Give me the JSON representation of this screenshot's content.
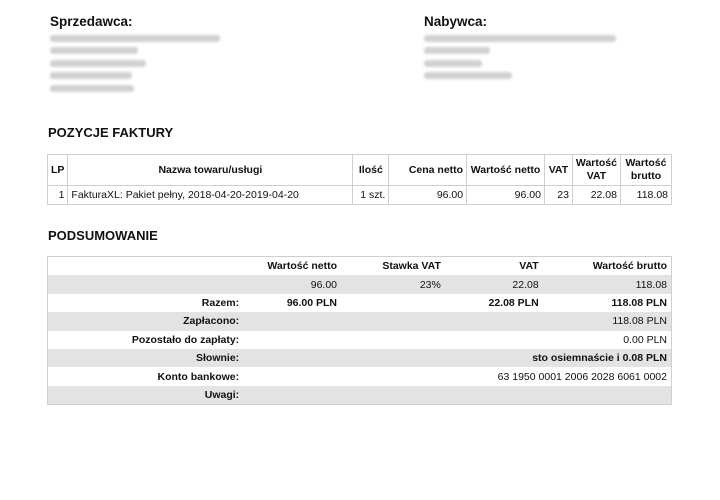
{
  "seller": {
    "title": "Sprzedawca:"
  },
  "buyer": {
    "title": "Nabywca:"
  },
  "items_section": {
    "title": "POZYCJE FAKTURY",
    "headers": {
      "lp": "LP",
      "name": "Nazwa towaru/usługi",
      "qty": "Ilość",
      "unit_net": "Cena netto",
      "net_value": "Wartość netto",
      "vat": "VAT",
      "vat_value_1": "Wartość",
      "vat_value_2": "VAT",
      "gross_1": "Wartość",
      "gross_2": "brutto"
    },
    "rows": [
      {
        "lp": "1",
        "name": "FakturaXL: Pakiet pełny, 2018-04-20-2019-04-20",
        "qty": "1 szt.",
        "unit_net": "96.00",
        "net_value": "96.00",
        "vat": "23",
        "vat_value": "22.08",
        "gross": "118.08"
      }
    ]
  },
  "summary_section": {
    "title": "PODSUMOWANIE",
    "headers": {
      "net": "Wartość netto",
      "rate": "Stawka VAT",
      "vat": "VAT",
      "gross": "Wartość brutto"
    },
    "rate_row": {
      "net": "96.00",
      "rate": "23%",
      "vat": "22.08",
      "gross": "118.08"
    },
    "total_row": {
      "label": "Razem:",
      "net": "96.00 PLN",
      "vat": "22.08 PLN",
      "gross": "118.08 PLN"
    },
    "paid": {
      "label": "Zapłacono:",
      "value": "118.08 PLN"
    },
    "remaining": {
      "label": "Pozostało do zapłaty:",
      "value": "0.00 PLN"
    },
    "in_words": {
      "label": "Słownie:",
      "value": "sto osiemnaście i 0.08 PLN"
    },
    "bank_account": {
      "label": "Konto bankowe:",
      "value": "63 1950 0001 2006 2028 6061 0002"
    },
    "notes": {
      "label": "Uwagi:",
      "value": ""
    }
  }
}
